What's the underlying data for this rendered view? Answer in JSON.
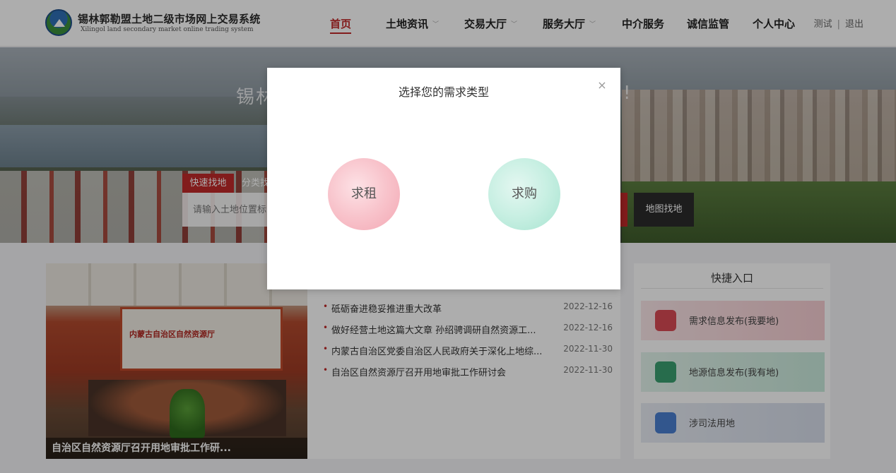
{
  "header": {
    "brand_cn": "锡林郭勒盟土地二级市场网上交易系统",
    "brand_en": "Xilingol land secondary market online trading system",
    "nav": [
      {
        "label": "首页",
        "active": true
      },
      {
        "label": "土地资讯",
        "dropdown": true
      },
      {
        "label": "交易大厅",
        "dropdown": true
      },
      {
        "label": "服务大厅",
        "dropdown": true
      },
      {
        "label": "中介服务"
      },
      {
        "label": "诚信监管"
      },
      {
        "label": "个人中心"
      }
    ],
    "caret": "﹀",
    "user": "测试",
    "separator": "|",
    "logout": "退出"
  },
  "banner": {
    "title_partial": "锡林",
    "title_tail": "!",
    "tabs": [
      "快速找地",
      "分类找"
    ],
    "search_placeholder": "请输入土地位置标",
    "map_button": "地图找地"
  },
  "photo": {
    "wall_text": "内蒙古自治区自然资源厅",
    "caption": "自治区自然资源厅召开用地审批工作研..."
  },
  "news": [
    {
      "title": "砥砺奋进稳妥推进重大改革",
      "date": "2022-12-16"
    },
    {
      "title": "做好经营土地这篇大文章 孙绍骋调研自然资源工...",
      "date": "2022-12-16"
    },
    {
      "title": "内蒙古自治区党委自治区人民政府关于深化上地综...",
      "date": "2022-11-30"
    },
    {
      "title": "自治区自然资源厅召开用地审批工作研讨会",
      "date": "2022-11-30"
    }
  ],
  "news_bullet": "•",
  "quick": {
    "title": "快捷入口",
    "items": [
      {
        "label": "需求信息发布(我要地)",
        "icon": "house-icon"
      },
      {
        "label": "地源信息发布(我有地)",
        "icon": "land-icon"
      },
      {
        "label": "涉司法用地",
        "icon": "person-icon"
      }
    ]
  },
  "modal": {
    "title": "选择您的需求类型",
    "close": "×",
    "rent": "求租",
    "buy": "求购"
  },
  "colors": {
    "accent": "#c02a2a",
    "rent": "#f3a7b3",
    "buy": "#a6e3d0"
  }
}
